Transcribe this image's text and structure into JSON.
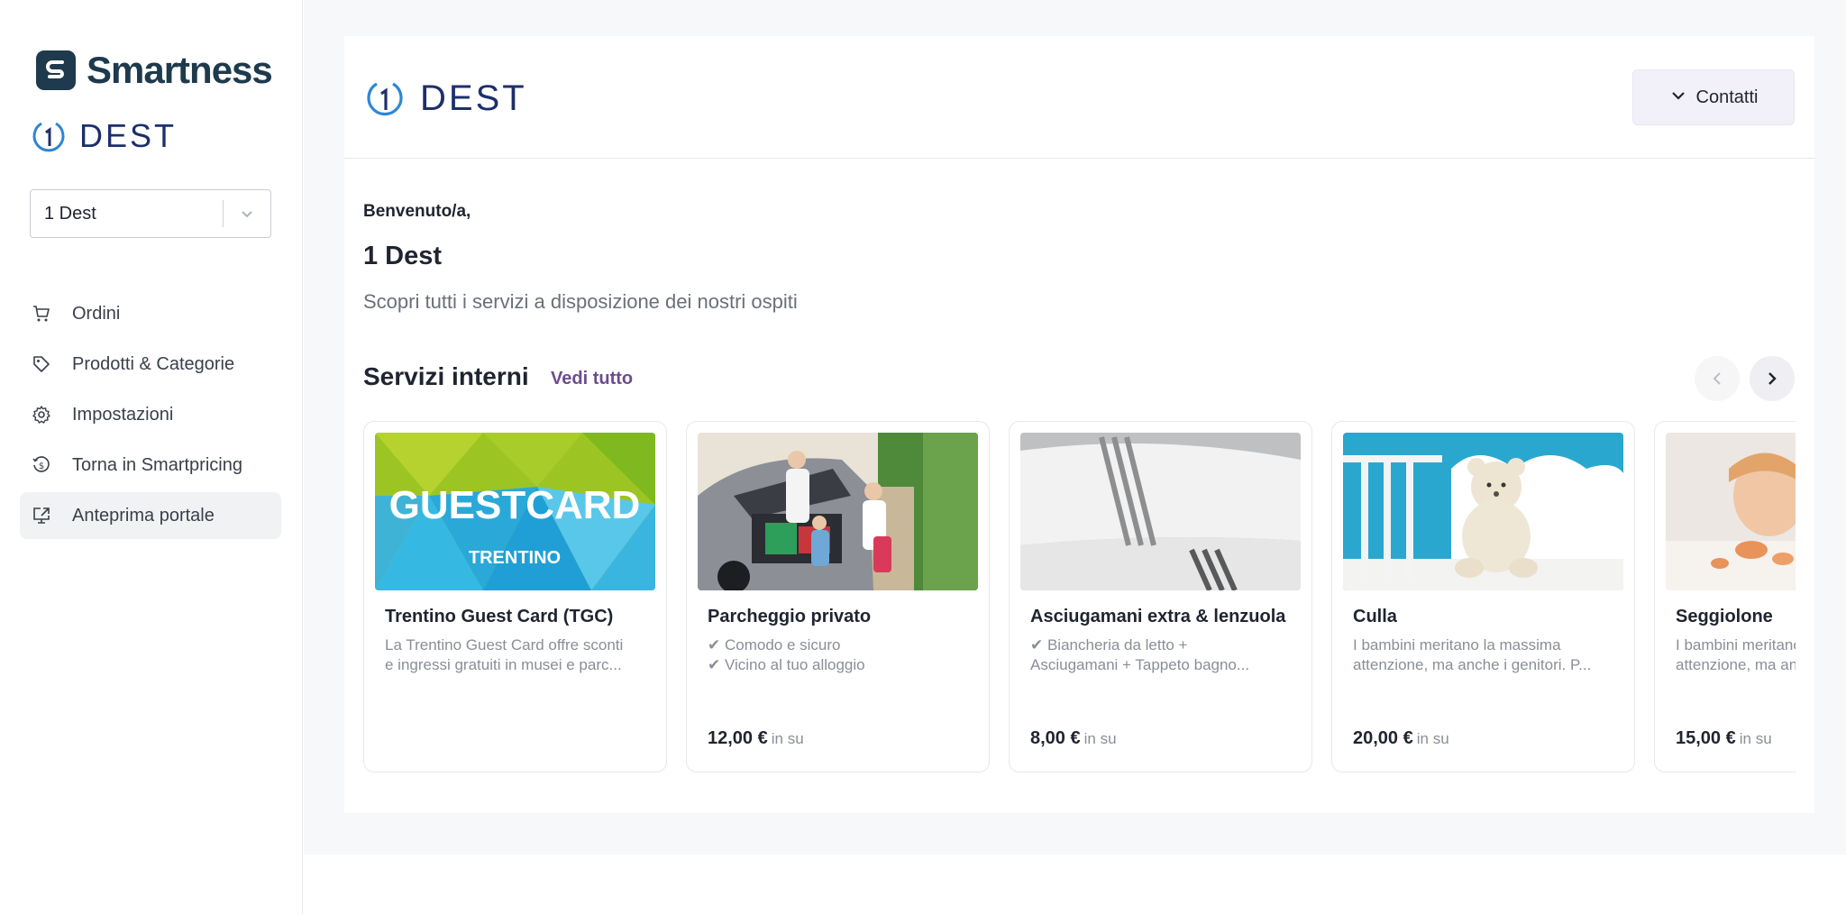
{
  "sidebar": {
    "brand": "Smartness",
    "property_logo_text": "DEST",
    "property_select": {
      "value": "1 Dest"
    },
    "items": [
      {
        "label": "Ordini",
        "icon": "cart-icon"
      },
      {
        "label": "Prodotti & Categorie",
        "icon": "tag-icon"
      },
      {
        "label": "Impostazioni",
        "icon": "gear-icon"
      },
      {
        "label": "Torna in Smartpricing",
        "icon": "dollar-refresh-icon"
      },
      {
        "label": "Anteprima portale",
        "icon": "external-screen-icon",
        "active": true
      }
    ]
  },
  "header": {
    "logo_text": "DEST",
    "contacts_label": "Contatti"
  },
  "welcome": {
    "greeting": "Benvenuto/a,",
    "property_name": "1 Dest",
    "subtitle": "Scopri tutti i servizi a disposizione dei nostri ospiti"
  },
  "services": {
    "title": "Servizi interni",
    "see_all": "Vedi tutto",
    "cards": [
      {
        "name": "Trentino Guest Card (TGC)",
        "desc1": "La Trentino Guest Card offre sconti",
        "desc2": "e ingressi gratuiti in musei e parc...",
        "price": "",
        "unit": ""
      },
      {
        "name": "Parcheggio privato",
        "desc1": "✔ Comodo e sicuro",
        "desc2": "✔ Vicino al tuo alloggio",
        "price": "12,00 €",
        "unit": "in su"
      },
      {
        "name": "Asciugamani extra & lenzuola",
        "desc1": "✔ Biancheria da letto +",
        "desc2": "Asciugamani + Tappeto bagno...",
        "price": "8,00 €",
        "unit": "in su"
      },
      {
        "name": "Culla",
        "desc1": "I bambini meritano la massima",
        "desc2": "attenzione, ma anche i genitori. P...",
        "price": "20,00 €",
        "unit": "in su"
      },
      {
        "name": "Seggiolone",
        "desc1": "I bambini meritano la massima",
        "desc2": "attenzione, ma anche i genitori.",
        "price": "15,00 €",
        "unit": "in su"
      }
    ],
    "guestcard_image_text": "GUESTCARD",
    "guestcard_image_subtext": "TRENTINO"
  },
  "colors": {
    "brand": "#1e3a4c",
    "dest_blue": "#1d2f6b",
    "accent_purple": "#6d4c8f"
  }
}
